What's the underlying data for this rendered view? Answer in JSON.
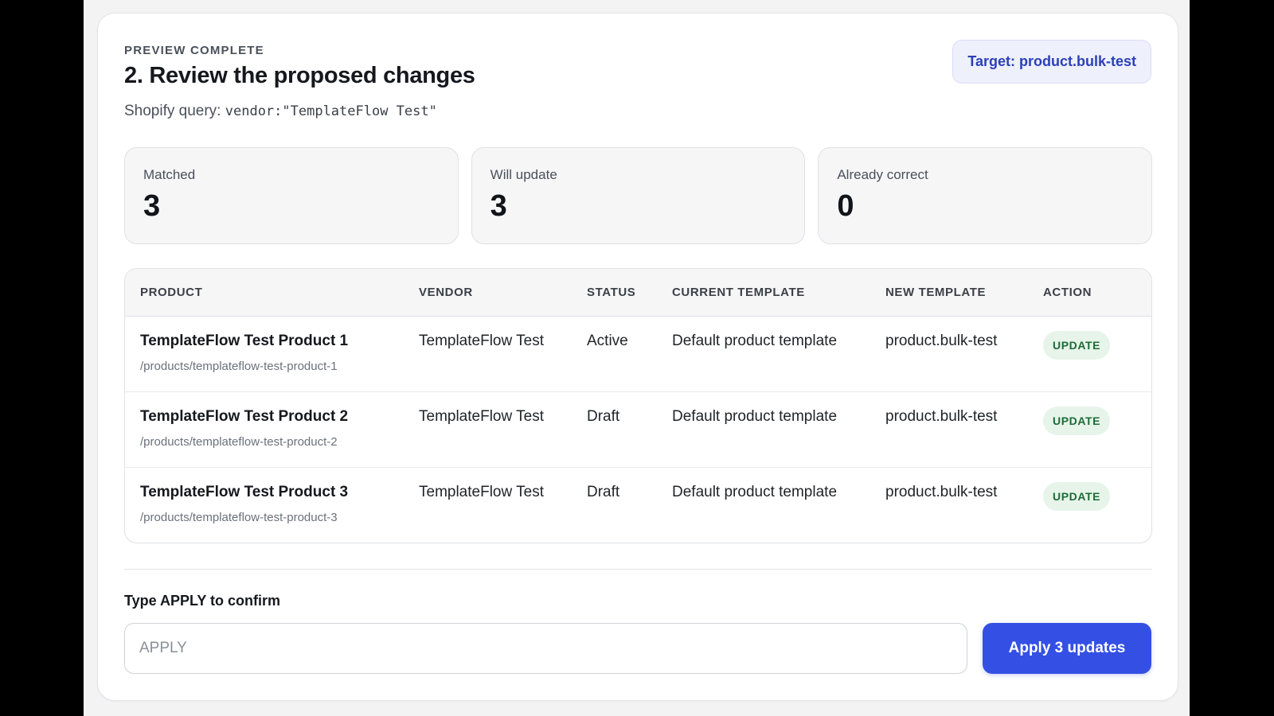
{
  "header": {
    "eyebrow": "PREVIEW COMPLETE",
    "title": "2. Review the proposed changes",
    "query_label": "Shopify query:",
    "query_value": "vendor:\"TemplateFlow Test\"",
    "target_badge": "Target: product.bulk-test"
  },
  "stats": [
    {
      "label": "Matched",
      "value": "3"
    },
    {
      "label": "Will update",
      "value": "3"
    },
    {
      "label": "Already correct",
      "value": "0"
    }
  ],
  "table": {
    "columns": [
      "PRODUCT",
      "VENDOR",
      "STATUS",
      "CURRENT TEMPLATE",
      "NEW TEMPLATE",
      "ACTION"
    ],
    "rows": [
      {
        "product": "TemplateFlow Test Product 1",
        "path": "/products/templateflow-test-product-1",
        "vendor": "TemplateFlow Test",
        "status": "Active",
        "current_template": "Default product template",
        "new_template": "product.bulk-test",
        "action": "UPDATE"
      },
      {
        "product": "TemplateFlow Test Product 2",
        "path": "/products/templateflow-test-product-2",
        "vendor": "TemplateFlow Test",
        "status": "Draft",
        "current_template": "Default product template",
        "new_template": "product.bulk-test",
        "action": "UPDATE"
      },
      {
        "product": "TemplateFlow Test Product 3",
        "path": "/products/templateflow-test-product-3",
        "vendor": "TemplateFlow Test",
        "status": "Draft",
        "current_template": "Default product template",
        "new_template": "product.bulk-test",
        "action": "UPDATE"
      }
    ]
  },
  "confirm": {
    "label": "Type APPLY to confirm",
    "placeholder": "APPLY",
    "value": "",
    "button_label": "Apply 3 updates"
  },
  "colors": {
    "accent": "#3450e4",
    "badge_text": "#2b3fb8",
    "pill_bg": "#e6f4ea",
    "pill_text": "#1e6b36"
  }
}
